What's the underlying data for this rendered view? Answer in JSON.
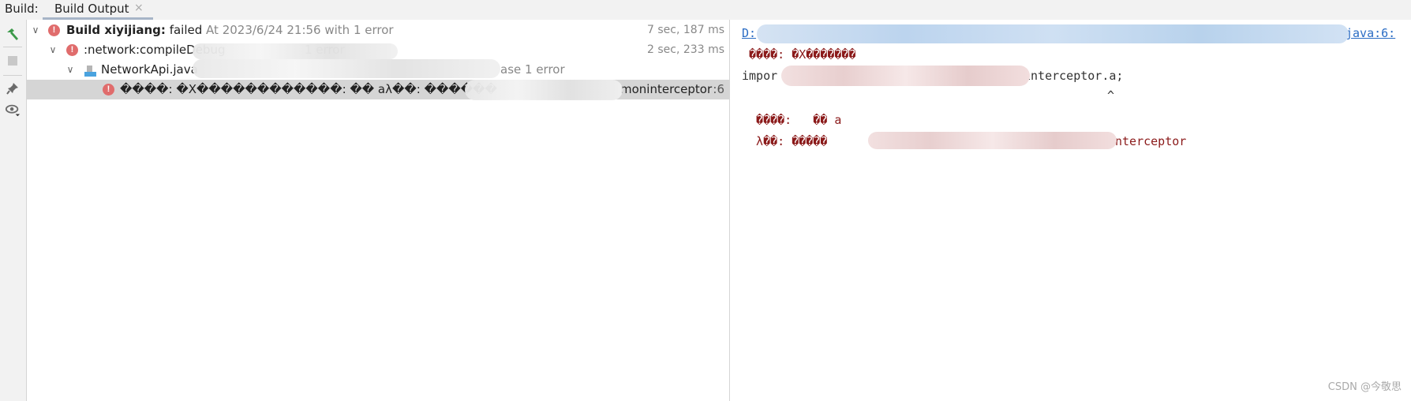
{
  "tabbar": {
    "label": "Build:",
    "tab": "Build Output",
    "close_glyph": "×"
  },
  "toolbar": {
    "icons": [
      "hammer-icon",
      "stop-icon",
      "pin-icon",
      "eye-icon"
    ]
  },
  "tree": {
    "rows": [
      {
        "title": "Build xiyijiang:",
        "status": "failed",
        "detail": "At 2023/6/24 21:56 with 1 error",
        "time": "7 sec, 187 ms"
      },
      {
        "title": ":network:compileDebug",
        "detail": "1 error",
        "time": "2 sec, 233 ms"
      },
      {
        "title": "NetworkApi.java",
        "detail": "ase 1 error"
      },
      {
        "title": "����: �X������������:  �� aλ��: ������",
        "suffix": "moninterceptor",
        "line": ":6"
      }
    ]
  },
  "console": {
    "path_prefix": "D:",
    "path_suffix": "java:6:",
    "line1": " ����: �X�������",
    "line2_prefix": "impor",
    "line2_suffix": "interceptor.a;",
    "caret": "^",
    "line3": "  ����:   �� a",
    "line4_prefix": "  λ��: �����",
    "line4_suffix": "nterceptor"
  },
  "watermark": "CSDN @今敬思"
}
